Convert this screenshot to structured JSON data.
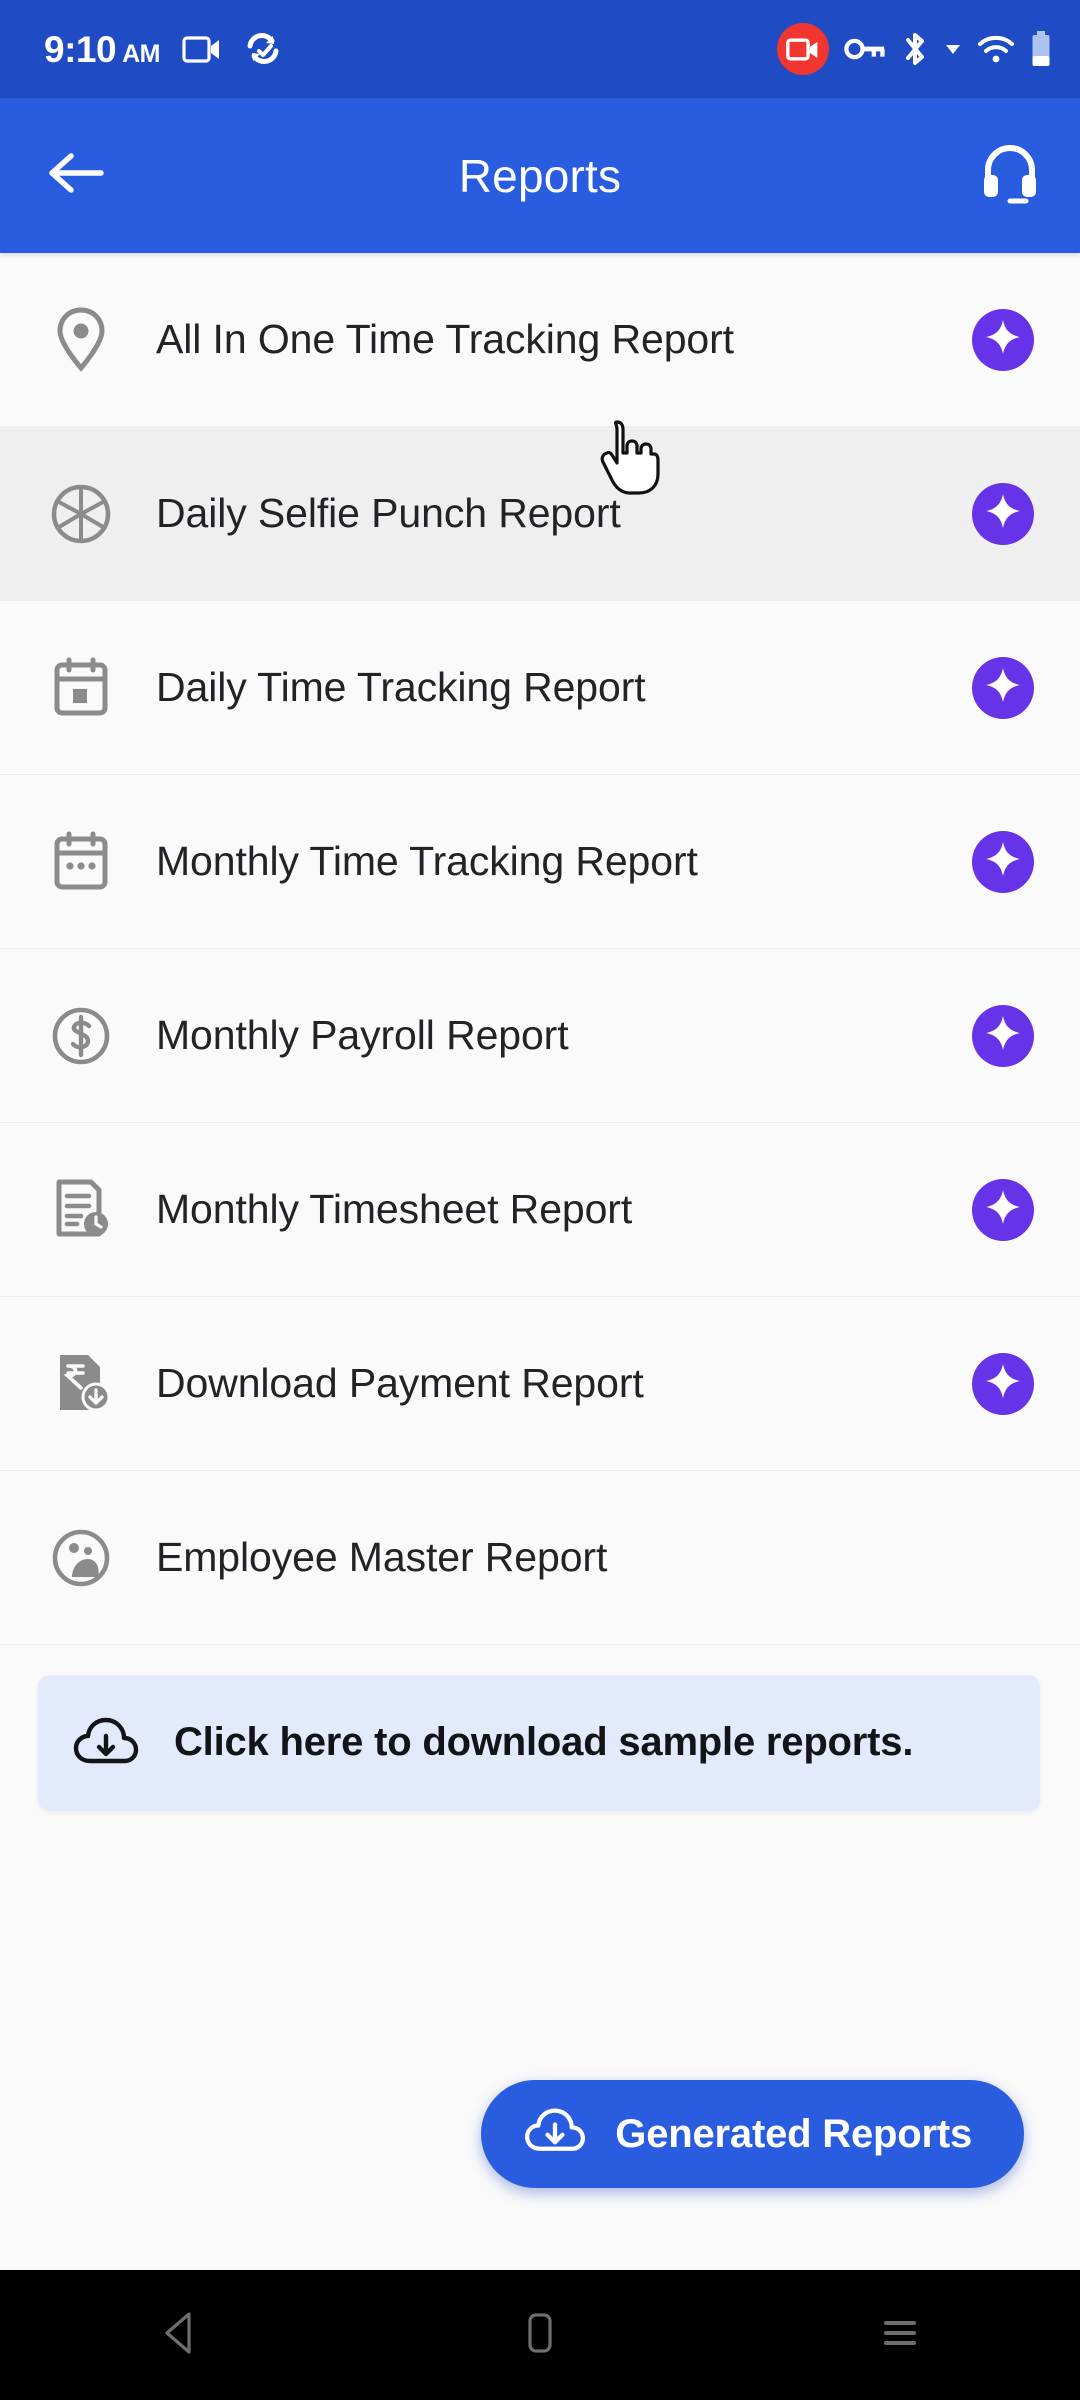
{
  "status_bar": {
    "time": "9:10",
    "ampm": "AM",
    "left_icons": [
      "video-call-icon",
      "sync-check-icon"
    ],
    "right_icons": [
      "screen-record-icon",
      "vpn-key-icon",
      "bluetooth-icon",
      "signal-dropdown-icon",
      "wifi-icon",
      "battery-icon"
    ],
    "background_color": "#1f4cc4",
    "recording_badge_color": "#f0362f"
  },
  "app_bar": {
    "title": "Reports",
    "back_icon": "arrow-left-icon",
    "support_icon": "headset-icon",
    "background_color": "#2a5ce0"
  },
  "reports": {
    "items": [
      {
        "label": "All In One Time Tracking Report",
        "icon": "location-pin-icon",
        "ai_badge": true,
        "highlighted": false
      },
      {
        "label": "Daily Selfie Punch Report",
        "icon": "camera-aperture-icon",
        "ai_badge": true,
        "highlighted": true
      },
      {
        "label": "Daily Time Tracking Report",
        "icon": "calendar-day-icon",
        "ai_badge": true,
        "highlighted": false
      },
      {
        "label": "Monthly Time Tracking Report",
        "icon": "calendar-month-icon",
        "ai_badge": true,
        "highlighted": false
      },
      {
        "label": "Monthly Payroll Report",
        "icon": "dollar-circle-icon",
        "ai_badge": true,
        "highlighted": false
      },
      {
        "label": "Monthly Timesheet Report",
        "icon": "document-clock-icon",
        "ai_badge": true,
        "highlighted": false
      },
      {
        "label": "Download Payment Report",
        "icon": "rupee-document-download-icon",
        "ai_badge": true,
        "highlighted": false
      },
      {
        "label": "Employee Master Report",
        "icon": "people-circle-icon",
        "ai_badge": false,
        "highlighted": false
      }
    ],
    "ai_badge_color": "#6633e8",
    "ai_badge_icon": "sparkle-icon"
  },
  "banner": {
    "text": "Click here to download sample reports.",
    "icon": "cloud-download-icon",
    "background_color": "#e2eafb"
  },
  "fab": {
    "label": "Generated Reports",
    "icon": "cloud-download-icon",
    "background_color": "#2a5ce0"
  },
  "nav_bar": {
    "back_icon": "nav-back-triangle-icon",
    "home_icon": "nav-home-square-icon",
    "recents_icon": "nav-recents-lines-icon"
  },
  "cursor": {
    "icon": "pointer-hand-cursor"
  }
}
